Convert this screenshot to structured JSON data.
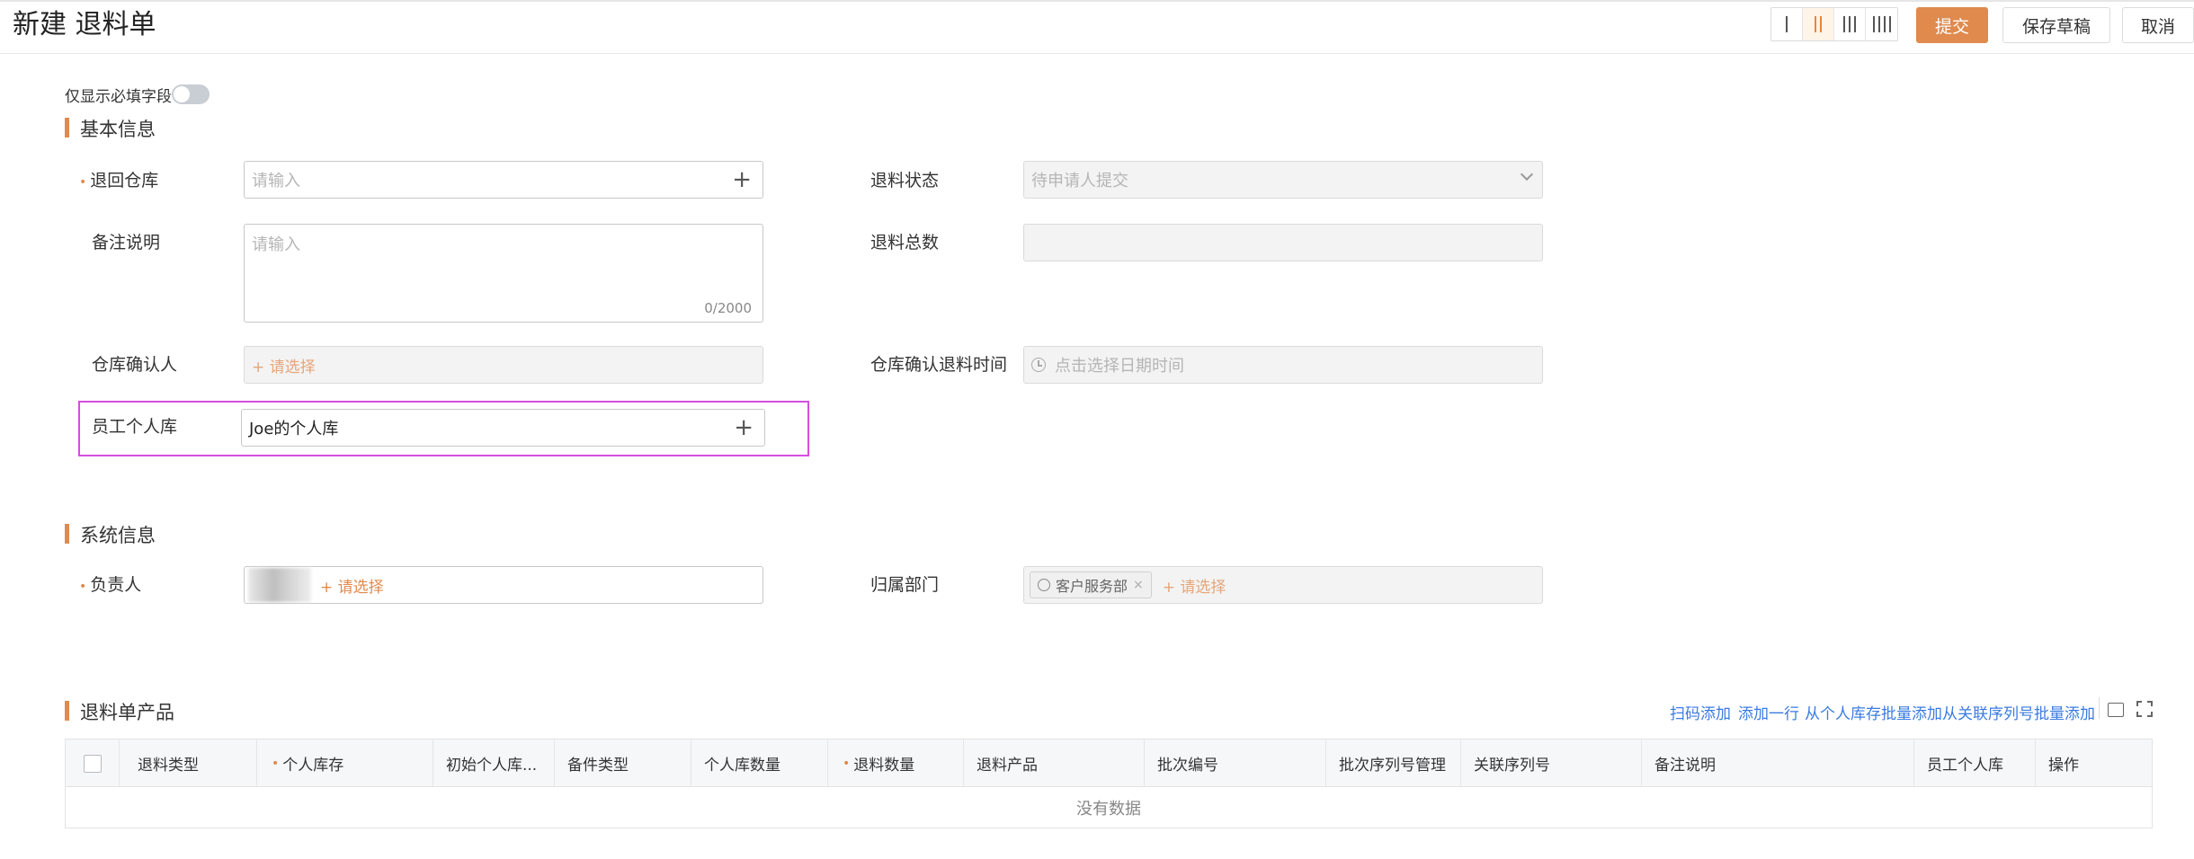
{
  "header": {
    "title": "新建 退料单",
    "layout_columns": [
      "1",
      "2",
      "3",
      "4"
    ],
    "active_layout": "2",
    "buttons": {
      "submit": "提交",
      "save_draft": "保存草稿",
      "cancel": "取消"
    }
  },
  "required_only_toggle": {
    "label": "仅显示必填字段",
    "on": false
  },
  "sections": {
    "basic": {
      "title": "基本信息",
      "return_warehouse": {
        "label": "退回仓库",
        "placeholder": "请输入",
        "required": true
      },
      "return_status": {
        "label": "退料状态",
        "value": "待申请人提交"
      },
      "remarks": {
        "label": "备注说明",
        "placeholder": "请输入",
        "counter": "0/2000"
      },
      "return_total": {
        "label": "退料总数",
        "value": ""
      },
      "warehouse_confirmer": {
        "label": "仓库确认人",
        "placeholder": "+ 请选择"
      },
      "warehouse_confirm_time": {
        "label": "仓库确认退料时间",
        "placeholder": "点击选择日期时间"
      },
      "employee_personal_store": {
        "label": "员工个人库",
        "value": "Joe的个人库"
      }
    },
    "system": {
      "title": "系统信息",
      "owner": {
        "label": "负责人",
        "select_hint": "+ 请选择",
        "required": true
      },
      "department": {
        "label": "归属部门",
        "tag": "客户服务部",
        "tag_close": "×",
        "select_hint": "+ 请选择"
      }
    },
    "products": {
      "title": "退料单产品",
      "actions": [
        "扫码添加",
        "添加一行",
        "从个人库存批量添加",
        "从关联序列号批量添加"
      ],
      "columns": [
        "退料类型",
        "个人库存",
        "初始个人库...",
        "备件类型",
        "个人库数量",
        "退料数量",
        "退料产品",
        "批次编号",
        "批次序列号管理",
        "关联序列号",
        "备注说明",
        "员工个人库",
        "操作"
      ],
      "empty_text": "没有数据"
    }
  },
  "colors": {
    "accent": "#e08a4d",
    "link": "#3a7be0",
    "highlight": "#d44ee0"
  }
}
